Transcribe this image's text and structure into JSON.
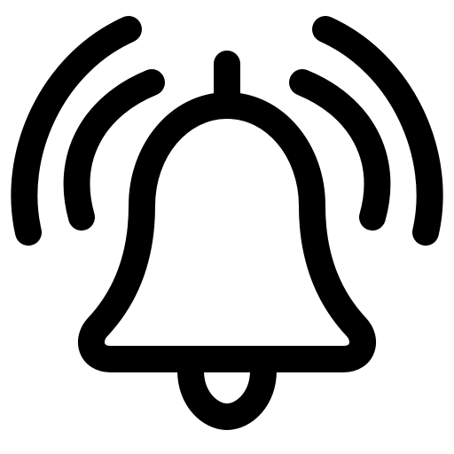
{
  "icon": {
    "name": "ringing-bell-icon",
    "color": "#000000",
    "background": "#ffffff"
  }
}
